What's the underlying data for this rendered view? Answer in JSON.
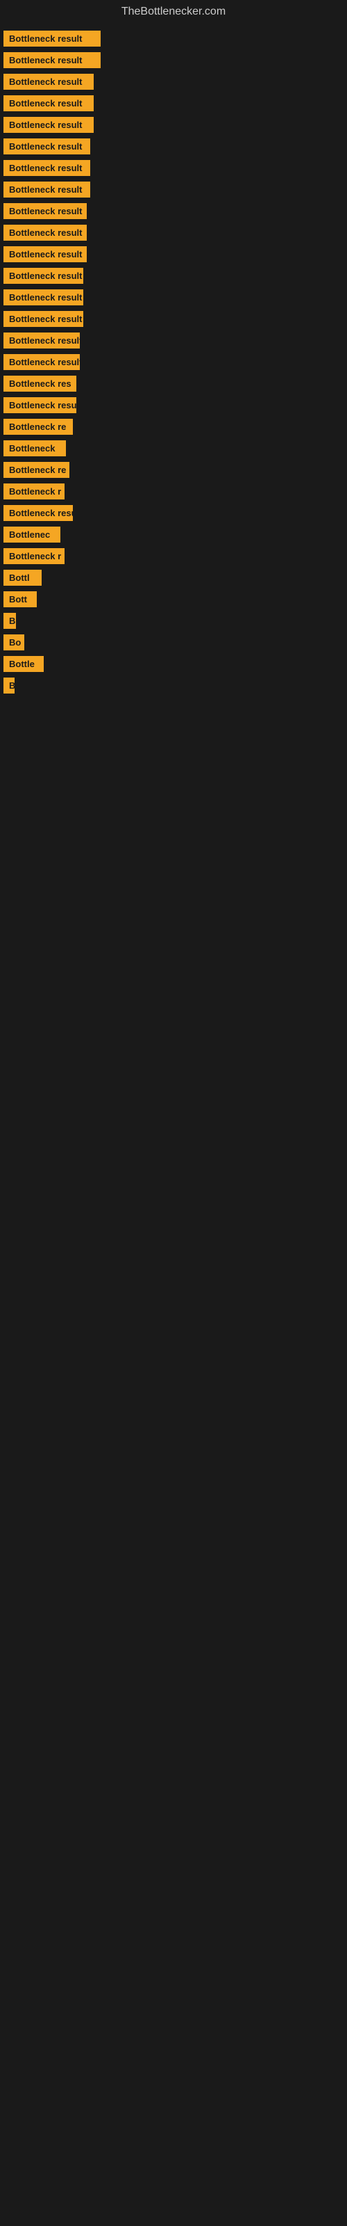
{
  "site": {
    "title": "TheBottlenecker.com"
  },
  "items": [
    {
      "label": "Bottleneck result",
      "width": 140
    },
    {
      "label": "Bottleneck result",
      "width": 140
    },
    {
      "label": "Bottleneck result",
      "width": 130
    },
    {
      "label": "Bottleneck result",
      "width": 130
    },
    {
      "label": "Bottleneck result",
      "width": 130
    },
    {
      "label": "Bottleneck result",
      "width": 125
    },
    {
      "label": "Bottleneck result",
      "width": 125
    },
    {
      "label": "Bottleneck result",
      "width": 125
    },
    {
      "label": "Bottleneck result",
      "width": 120
    },
    {
      "label": "Bottleneck result",
      "width": 120
    },
    {
      "label": "Bottleneck result",
      "width": 120
    },
    {
      "label": "Bottleneck result",
      "width": 115
    },
    {
      "label": "Bottleneck result",
      "width": 115
    },
    {
      "label": "Bottleneck result",
      "width": 115
    },
    {
      "label": "Bottleneck result",
      "width": 110
    },
    {
      "label": "Bottleneck result",
      "width": 110
    },
    {
      "label": "Bottleneck res",
      "width": 105
    },
    {
      "label": "Bottleneck result",
      "width": 105
    },
    {
      "label": "Bottleneck re",
      "width": 100
    },
    {
      "label": "Bottleneck",
      "width": 90
    },
    {
      "label": "Bottleneck re",
      "width": 95
    },
    {
      "label": "Bottleneck r",
      "width": 88
    },
    {
      "label": "Bottleneck resu",
      "width": 100
    },
    {
      "label": "Bottlenec",
      "width": 82
    },
    {
      "label": "Bottleneck r",
      "width": 88
    },
    {
      "label": "Bottl",
      "width": 55
    },
    {
      "label": "Bott",
      "width": 48
    },
    {
      "label": "B",
      "width": 18
    },
    {
      "label": "Bo",
      "width": 30
    },
    {
      "label": "Bottle",
      "width": 58
    },
    {
      "label": "B",
      "width": 14
    }
  ]
}
